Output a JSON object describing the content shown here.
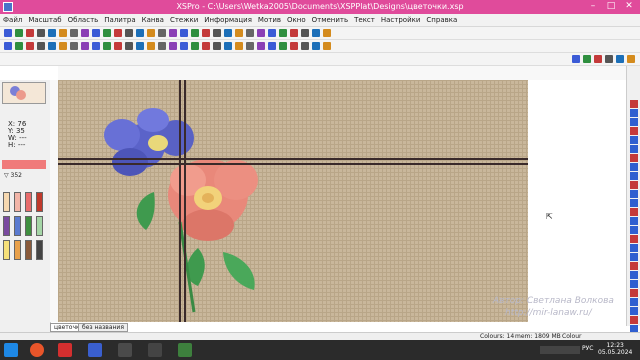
{
  "window": {
    "title": "XSPro - C:\\Users\\Wetka2005\\Documents\\XSPPlat\\Designs\\цветочки.xsp"
  },
  "menu": [
    "Файл",
    "Масштаб",
    "Область",
    "Палитра",
    "Канва",
    "Стежки",
    "Информация",
    "Мотив",
    "Окно",
    "Отменить",
    "Текст",
    "Настройки",
    "Справка"
  ],
  "coords": {
    "x_label": "X:",
    "x_value": "76",
    "y_label": "Y:",
    "y_value": "35",
    "w_label": "W:",
    "w_value": "---",
    "h_label": "H:",
    "h_value": "---"
  },
  "palette": {
    "count": "352"
  },
  "tabs": [
    "цветочки",
    "без названия"
  ],
  "watermark": {
    "author": "Автор: Светлана Волкова",
    "site": "http://mir-lanaw.ru/"
  },
  "status": {
    "colours": "Colours: 14",
    "mem": "mem: 1809 MB",
    "mode": "Colour"
  },
  "clock": {
    "time": "12:23",
    "date": "05.05.2024",
    "lang": "РУС"
  },
  "colors": {
    "titlebar": "#e04b9b",
    "fabric": "#c9b79b",
    "flower_blue": "#5b63c9",
    "flower_pink": "#e9887a",
    "leaf": "#3f9a4e"
  }
}
